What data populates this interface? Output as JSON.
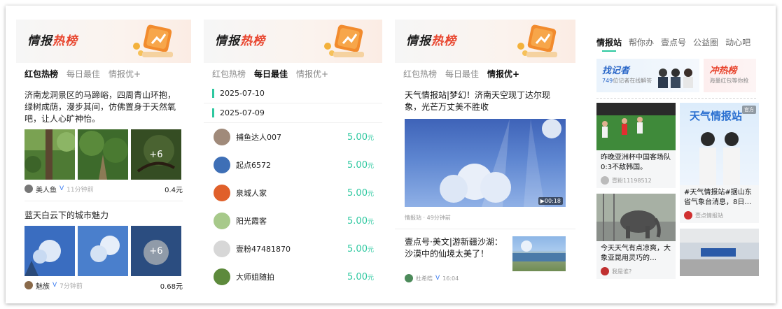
{
  "panel1": {
    "banner": {
      "title_a": "情报",
      "title_b": "热榜"
    },
    "tabs": [
      {
        "label": "红包热榜",
        "active": true
      },
      {
        "label": "每日最佳",
        "active": false
      },
      {
        "label": "情报优+",
        "active": false
      }
    ],
    "items": [
      {
        "text": "济南龙洞景区的马蹄峪，四周青山环抱，绿树成荫，漫步其间，仿佛置身于天然氧吧，让人心旷神怡。",
        "more": "+6",
        "author": "美人鱼",
        "badge": "V",
        "time": "11分钟前",
        "amount": "0.4元"
      },
      {
        "text": "蓝天白云下的城市魅力",
        "more": "+6",
        "author": "魅族",
        "badge": "V",
        "time": "7分钟前",
        "amount": "0.68元"
      }
    ]
  },
  "panel2": {
    "banner": {
      "title_a": "情报",
      "title_b": "热榜"
    },
    "tabs": [
      {
        "label": "红包热榜",
        "active": false
      },
      {
        "label": "每日最佳",
        "active": true
      },
      {
        "label": "情报优+",
        "active": false
      }
    ],
    "dates": [
      "2025-07-10",
      "2025-07-09"
    ],
    "users": [
      {
        "name": "捕鱼达人007",
        "amount": "5.00",
        "unit": "元",
        "color": "#a08a7a"
      },
      {
        "name": "起点6572",
        "amount": "5.00",
        "unit": "元",
        "color": "#3e6fb6"
      },
      {
        "name": "泉城人家",
        "amount": "5.00",
        "unit": "元",
        "color": "#e0602a"
      },
      {
        "name": "阳光霞客",
        "amount": "5.00",
        "unit": "元",
        "color": "#a7c98a"
      },
      {
        "name": "壹粉47481870",
        "amount": "5.00",
        "unit": "元",
        "color": "#d7d7d7"
      },
      {
        "name": "大师姐随拍",
        "amount": "5.00",
        "unit": "元",
        "color": "#5d8a3c"
      }
    ]
  },
  "panel3": {
    "banner": {
      "title_a": "情报",
      "title_b": "热榜"
    },
    "tabs": [
      {
        "label": "红包热榜",
        "active": false
      },
      {
        "label": "每日最佳",
        "active": false
      },
      {
        "label": "情报优+",
        "active": true
      }
    ],
    "video_title": "天气情报站|梦幻！济南天空现丁达尔现象，光芒万丈美不胜收",
    "duration": "▶00:18",
    "video_meta": "情报站 · 49分钟前",
    "news_text": "壹点号·美文|游新疆沙湖：沙漠中的仙境太美了！",
    "news_author": "杜希皓",
    "news_badge": "V",
    "news_time": "16:04"
  },
  "panel4": {
    "tabs": [
      {
        "label": "情报站",
        "active": true
      },
      {
        "label": "帮你办",
        "active": false
      },
      {
        "label": "壹点号",
        "active": false
      },
      {
        "label": "公益圈",
        "active": false
      },
      {
        "label": "动心吧",
        "active": false
      }
    ],
    "promo_a": {
      "title": "找记者",
      "count": "749",
      "sub": "位记者在线解答"
    },
    "promo_b": {
      "title": "冲热榜",
      "sub": "海量红包等你抢"
    },
    "cards": [
      {
        "text": "昨晚亚洲杯中国客场队 0:3不敌韩国。",
        "author": "壹粉11198512"
      },
      {
        "text": "今天天气有点凉爽，大象亚昆用灵巧的…",
        "author": "我是谁?"
      },
      {
        "banner": "天气情报站",
        "tag": "官方",
        "text": "#天气情报站#据山东省气象台消息，8日…",
        "author": "壹点情报站"
      }
    ]
  }
}
